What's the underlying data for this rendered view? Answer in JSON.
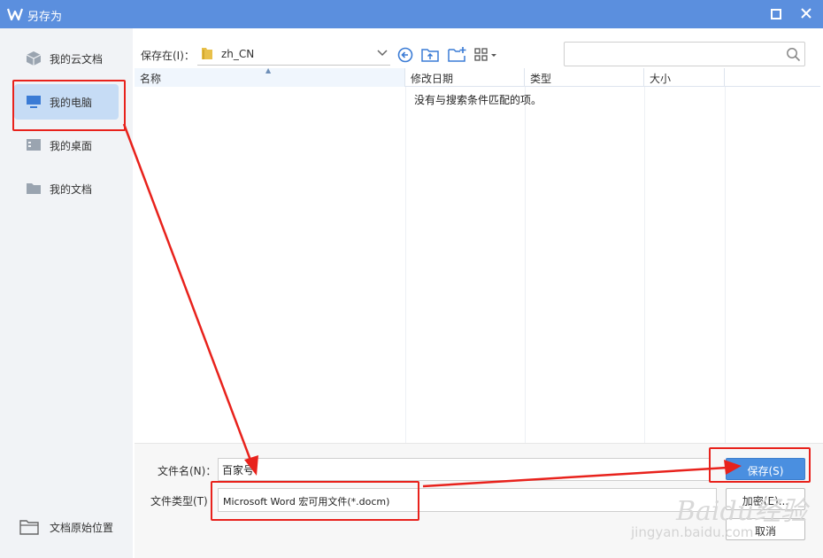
{
  "window": {
    "title": "另存为"
  },
  "sidebar": {
    "items": [
      {
        "label": "我的云文档",
        "icon": "cloud-doc-icon"
      },
      {
        "label": "我的电脑",
        "icon": "computer-icon",
        "active": true
      },
      {
        "label": "我的桌面",
        "icon": "desktop-icon"
      },
      {
        "label": "我的文档",
        "icon": "folder-icon"
      }
    ],
    "original_location": "文档原始位置"
  },
  "toolbar": {
    "location_label": "保存在(I)：",
    "location_value": "zh_CN",
    "search_placeholder": ""
  },
  "file_list": {
    "columns": [
      "名称",
      "修改日期",
      "类型",
      "大小"
    ],
    "empty_message": "没有与搜索条件匹配的项。"
  },
  "form": {
    "filename_label": "文件名(N)：",
    "filename_value": "百家号",
    "filetype_label": "文件类型(T)",
    "filetype_value": "Microsoft Word 宏可用文件(*.docm)"
  },
  "buttons": {
    "save": "保存(S)",
    "encrypt": "加密(E)...",
    "cancel": "取消"
  },
  "watermark": {
    "text": "Baidu经验",
    "sub": "jingyan.baidu.com"
  },
  "colors": {
    "titlebar": "#5b8fde",
    "accent": "#4a8fe0",
    "annotation": "#e8221c"
  }
}
